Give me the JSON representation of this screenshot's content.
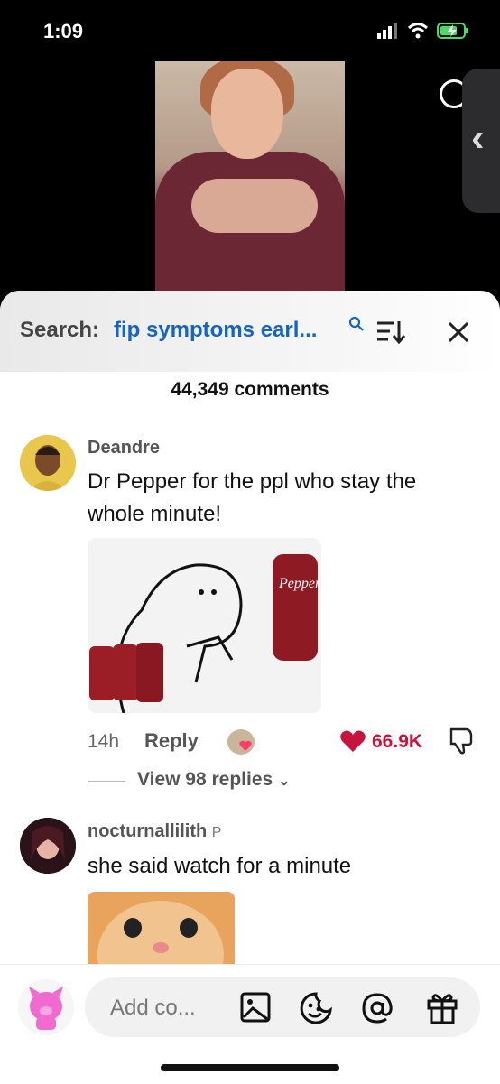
{
  "status_bar": {
    "time": "1:09"
  },
  "search": {
    "label": "Search:",
    "query": "fip symptoms earl..."
  },
  "comments_count": "44,349 comments",
  "comments": [
    {
      "username": "Deandre",
      "text_line1": "Dr Pepper for the ppl who stay the",
      "text_line2": "whole minute!",
      "age": "14h",
      "reply_label": "Reply",
      "likes": "66.9K",
      "view_replies": "View 98 replies"
    },
    {
      "username": "nocturnallilith",
      "text": "she said watch for a minute"
    }
  ],
  "input": {
    "placeholder": "Add co..."
  },
  "colors": {
    "accent_blue": "#1565c0",
    "like_red": "#c8143c"
  },
  "icons": [
    "search-icon",
    "sort-icon",
    "close-icon",
    "heart-icon",
    "dislike-icon",
    "chevron-down-icon",
    "image-icon",
    "emoji-icon",
    "mention-icon",
    "gift-icon"
  ]
}
